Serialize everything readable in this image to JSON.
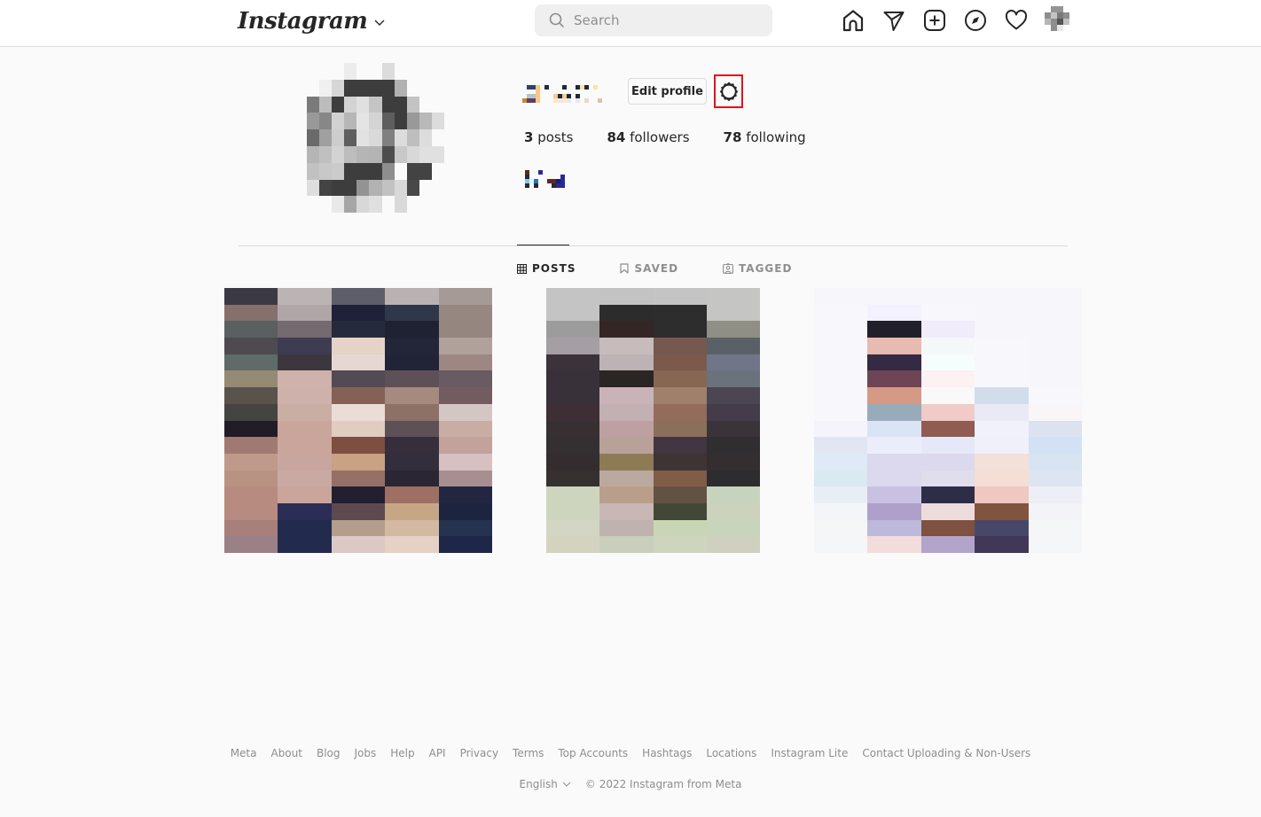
{
  "app": {
    "name": "Instagram"
  },
  "nav": {
    "logo_text": "Instagram",
    "search": {
      "placeholder": "Search",
      "value": ""
    },
    "icons": [
      "home-icon",
      "direct-message-icon",
      "new-post-icon",
      "explore-icon",
      "activity-heart-icon",
      "profile-avatar-icon"
    ]
  },
  "profile": {
    "username_redacted": true,
    "edit_profile_label": "Edit profile",
    "settings_icon": "gear-icon",
    "settings_highlight_color": "#e0141e",
    "stats": {
      "posts_count": "3",
      "posts_label": "posts",
      "followers_count": "84",
      "followers_label": "followers",
      "following_count": "78",
      "following_label": "following"
    },
    "bio_redacted": true
  },
  "tabs": [
    {
      "label": "POSTS",
      "icon": "grid-icon",
      "active": true
    },
    {
      "label": "SAVED",
      "icon": "bookmark-icon",
      "active": false
    },
    {
      "label": "TAGGED",
      "icon": "tagged-person-icon",
      "active": false
    }
  ],
  "posts": [
    {
      "pixelated": true,
      "colors": [
        "#3a3944",
        "#bcb3b4",
        "#5e5d6a",
        "#bab1b2",
        "#a69a97",
        "#85706b",
        "#b0a6a7",
        "#1e2137",
        "#2f384b",
        "#968781",
        "#5a605f",
        "#756a70",
        "#252a3c",
        "#1f2232",
        "#958680",
        "#4d4b4f",
        "#3e3c51",
        "#e4d3c6",
        "#232638",
        "#b1a19b",
        "#5f6b68",
        "#3c373e",
        "#e6d8d1",
        "#212336",
        "#9d8783",
        "#958a74",
        "#cfb2ac",
        "#524b53",
        "#5e5057",
        "#685b61",
        "#5a534c",
        "#cfb1ab",
        "#856155",
        "#a68a7f",
        "#735c61",
        "#444440",
        "#c8aea3",
        "#ecdcd6",
        "#8d7066",
        "#d4c6c5",
        "#221c27",
        "#c9a59c",
        "#e0cdc0",
        "#5e5057",
        "#c9aca4",
        "#a07973",
        "#c9a59c",
        "#7e4e40",
        "#362f3b",
        "#c2a29a",
        "#bf9a8b",
        "#c9a59f",
        "#c9a183",
        "#332e3b",
        "#d7c0c1",
        "#b89383",
        "#cba9a3",
        "#966f65",
        "#2b2634",
        "#a78f91",
        "#b78b7f",
        "#c9a59c",
        "#221f31",
        "#9d7063",
        "#222641",
        "#b78b7f",
        "#2b2d57",
        "#5c4a4f",
        "#c7a686",
        "#1d2440",
        "#a7807b",
        "#222b4d",
        "#b59d8e",
        "#d3b9a2",
        "#253250",
        "#9c8087",
        "#222b4d",
        "#dcc8c4",
        "#e5d2c5",
        "#1e2747"
      ]
    },
    {
      "pixelated": true,
      "colors": [
        "#c4c4c4",
        "#c3c3c3",
        "#c4c4c4",
        "#c5c5c4",
        "#c4c4c4",
        "#2c2c2c",
        "#2d2d2d",
        "#c5c5c4",
        "#9c9c9c",
        "#342624",
        "#2d2d2d",
        "#8f8f86",
        "#a69ea5",
        "#c7bbbb",
        "#75594f",
        "#5a6067",
        "#3b323a",
        "#bdb2b5",
        "#7b5a4c",
        "#707688",
        "#383139",
        "#2b2623",
        "#886654",
        "#6a737c",
        "#383139",
        "#c9b3b9",
        "#9f806a",
        "#4b4652",
        "#3e2f36",
        "#c3b0b2",
        "#946c5c",
        "#443c4a",
        "#363032",
        "#bfa0a2",
        "#8a705a",
        "#3b333a",
        "#343031",
        "#b8a198",
        "#413641",
        "#302e30",
        "#332d2f",
        "#8d7b56",
        "#3e3433",
        "#332e2f",
        "#363030",
        "#bba99f",
        "#805d47",
        "#2d2d2f",
        "#cdd5bf",
        "#b99f8b",
        "#625244",
        "#c6d4bd",
        "#cdd5bf",
        "#c9b7b6",
        "#414836",
        "#ccd2bc",
        "#d2d7c4",
        "#bfb3b0",
        "#cad5b5",
        "#c8d4bb",
        "#d3d3c0",
        "#c9cfba",
        "#cdd5be",
        "#cfd1be"
      ]
    },
    {
      "pixelated": true,
      "colors": [
        "#f7f6fa",
        "#f7f6fa",
        "#f7f6fa",
        "#f7f6fa",
        "#f7f6fa",
        "#f8f7fb",
        "#f2f1fd",
        "#f8f7fb",
        "#f7f6fa",
        "#f7f6fa",
        "#f8f7fb",
        "#21202a",
        "#f0ecfa",
        "#f7f6fa",
        "#f7f6fa",
        "#f8f7fb",
        "#e8bbb1",
        "#f4f8f8",
        "#f8f7fb",
        "#f7f6fa",
        "#f8f7fb",
        "#342a43",
        "#f6fdfd",
        "#f8f7fb",
        "#f7f6fa",
        "#f8f7fb",
        "#6e4556",
        "#fdf1f4",
        "#f8f7fb",
        "#f7f6fa",
        "#f8f7fb",
        "#d49a86",
        "#f9f9f9",
        "#d1ddeb",
        "#f8f7fb",
        "#f8f7fb",
        "#98abbb",
        "#f0cbc8",
        "#e9eaf5",
        "#faf6f8",
        "#f6f4fb",
        "#d9e4f5",
        "#905c51",
        "#f0f1fb",
        "#dce2ef",
        "#e2e6f3",
        "#ecedfa",
        "#e5e8f8",
        "#eff0fa",
        "#d2e2f4",
        "#deeaf5",
        "#dcd8ee",
        "#dcd8ee",
        "#f3e0d9",
        "#d8e4f1",
        "#d9eaf0",
        "#dcd8ee",
        "#e0ddec",
        "#f4ded6",
        "#dde5f3",
        "#e7eef5",
        "#c8c1e1",
        "#2d2d48",
        "#eec8c1",
        "#eeeef6",
        "#f4f5f9",
        "#afa0cb",
        "#eedcdc",
        "#80543f",
        "#f4f4f8",
        "#f5f6f8",
        "#bdb9db",
        "#7f5140",
        "#474869",
        "#f5f6f8",
        "#f5f6f8",
        "#f3dcdc",
        "#b3a4cb",
        "#413858",
        "#f5f6f8"
      ]
    }
  ],
  "avatar_colors": [
    "#fafafa",
    "#fafafa",
    "#fafafa",
    "#ececec",
    "#fafafa",
    "#fafafa",
    "#dcdcdc",
    "#fafafa",
    "#fafafa",
    "#fafafa",
    "#fafafa",
    "#fafafa",
    "#f0f0f0",
    "#d6d6d6",
    "#3d3d3d",
    "#3d3d3d",
    "#3d3d3d",
    "#3d3d3d",
    "#b1b1b1",
    "#fafafa",
    "#fafafa",
    "#fafafa",
    "#7a7a7a",
    "#bcbcbc",
    "#3d3d3d",
    "#d3d3d3",
    "#e0e0e0",
    "#c5c5c5",
    "#3d3d3d",
    "#3d3d3d",
    "#c3c3c3",
    "#fafafa",
    "#fafafa",
    "#999999",
    "#878787",
    "#d1d1d1",
    "#b6b6b6",
    "#e4e4e4",
    "#d4d4d4",
    "#5e5e5e",
    "#3d3d3d",
    "#999999",
    "#b9b9b9",
    "#dcdcdc",
    "#6a6a6a",
    "#a0a0a0",
    "#cdcdcd",
    "#5f5f5f",
    "#e2e2e2",
    "#dadada",
    "#808080",
    "#dcdcdc",
    "#bebebe",
    "#dcdcdc",
    "#fafafa",
    "#b5b5b5",
    "#c0c0c0",
    "#d3d3d3",
    "#bdbdbd",
    "#b5b5b5",
    "#b4b4b4",
    "#4d4d4d",
    "#c8c8c8",
    "#d8d8d8",
    "#e0e0e0",
    "#e0e0e0",
    "#c1c1c1",
    "#c8c8c8",
    "#cbcbcb",
    "#3d3d3d",
    "#3d3d3d",
    "#3d3d3d",
    "#8e8e8e",
    "#fafafa",
    "#434343",
    "#434343",
    "#fafafa",
    "#dedede",
    "#434343",
    "#3d3d3d",
    "#3d3d3d",
    "#939393",
    "#b2b2b2",
    "#c2c2c2",
    "#d8d8d8",
    "#484848",
    "#fafafa",
    "#fafafa",
    "#fafafa",
    "#fafafa",
    "#e9e9e9",
    "#a6a6a6",
    "#d8d8d8",
    "#dfdfdf",
    "#fafafa",
    "#d9d9d9",
    "#fafafa",
    "#fafafa",
    "#fafafa"
  ],
  "nav_avatar_colors": [
    "transparent",
    "#959595",
    "#959595",
    "transparent",
    "#8e8e8e",
    "#c4c4c4",
    "#7a7a7a",
    "#8e8e8e",
    "#b5b5b5",
    "#8e8e8e",
    "#555555",
    "#c0c0c0",
    "transparent",
    "#8e8e8e",
    "#e8e8e8",
    "transparent"
  ],
  "username_colors": [
    "transparent",
    "#2d4468",
    "#2d4468",
    "#f8c880",
    "transparent",
    "#1f2f3f",
    "transparent",
    "transparent",
    "transparent",
    "#1f2937",
    "transparent",
    "transparent",
    "#1f2937",
    "#fde3a7",
    "#1f2937",
    "transparent",
    "#fde3a7",
    "transparent",
    "transparent",
    "transparent",
    "transparent",
    "transparent",
    "transparent",
    "transparent",
    "#f8c880",
    "transparent",
    "transparent",
    "transparent",
    "transparent",
    "transparent",
    "transparent",
    "transparent",
    "transparent",
    "transparent",
    "transparent",
    "transparent",
    "transparent",
    "transparent",
    "transparent",
    "transparent",
    "transparent",
    "transparent",
    "transparent",
    "#b8c4c8",
    "#b8c4c8",
    "#f8c880",
    "transparent",
    "transparent",
    "transparent",
    "#fbc98a",
    "#1f2937",
    "#fbc98a",
    "#1f2937",
    "transparent",
    "#1f2937",
    "transparent",
    "transparent",
    "transparent",
    "transparent",
    "transparent",
    "transparent",
    "transparent",
    "transparent",
    "#cc8a26",
    "#5e3e63",
    "#5e3e63",
    "#f8c880",
    "transparent",
    "transparent",
    "transparent",
    "#fde7c6",
    "#ebe8ec",
    "#fde7c6",
    "#ebe8ec",
    "transparent",
    "#ebe8ec",
    "transparent",
    "#e8dcc3",
    "transparent",
    "transparent",
    "#d8c4ae",
    "transparent",
    "transparent",
    "transparent"
  ],
  "bio_colors": [
    "#5a2828",
    "transparent",
    "transparent",
    "#2a2a90",
    "transparent",
    "transparent",
    "transparent",
    "transparent",
    "transparent",
    "transparent",
    "#2a2a2a",
    "transparent",
    "transparent",
    "transparent",
    "transparent",
    "transparent",
    "transparent",
    "transparent",
    "#2a2a90",
    "transparent",
    "#86c8f0",
    "#d8f8ff",
    "#3070b0",
    "transparent",
    "transparent",
    "#5a2828",
    "#5a2828",
    "#1a1a80",
    "#2a2a90",
    "transparent",
    "#2a2a2a",
    "transparent",
    "#2a2a2a",
    "transparent",
    "transparent",
    "transparent",
    "#2a2a2a",
    "#2a2a90",
    "#2a2a90",
    "transparent"
  ],
  "footer": {
    "links": [
      "Meta",
      "About",
      "Blog",
      "Jobs",
      "Help",
      "API",
      "Privacy",
      "Terms",
      "Top Accounts",
      "Hashtags",
      "Locations",
      "Instagram Lite",
      "Contact Uploading & Non-Users"
    ],
    "language": "English",
    "copyright": "© 2022 Instagram from Meta"
  }
}
